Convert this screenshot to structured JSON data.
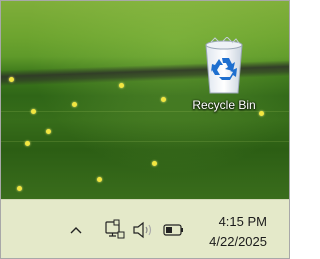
{
  "desktop": {
    "icons": [
      {
        "label": "Recycle Bin",
        "icon": "recycle-bin-icon"
      }
    ]
  },
  "taskbar": {
    "tray": {
      "show_hidden_icon": "chevron-up-icon",
      "network_icon": "network-icon",
      "volume_icon": "speaker-icon",
      "battery_icon": "battery-icon"
    },
    "clock": {
      "time": "4:15 PM",
      "date": "4/22/2025"
    }
  },
  "colors": {
    "taskbar_bg": "#e4e9c9",
    "recycle_accent": "#1e6fcf"
  }
}
